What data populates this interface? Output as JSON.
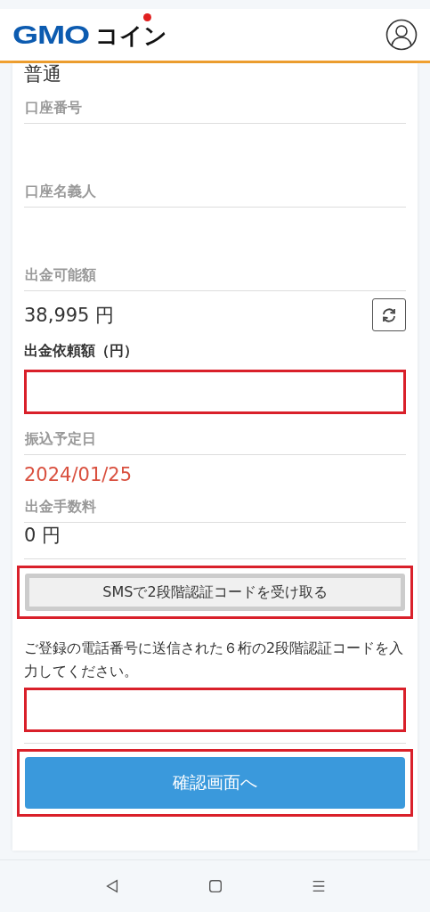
{
  "header": {
    "logo": {
      "latin": "GMO",
      "kana": "コイン"
    }
  },
  "account": {
    "type": "普通",
    "fields": [
      {
        "label": "口座番号"
      },
      {
        "label": "口座名義人"
      }
    ]
  },
  "available": {
    "label": "出金可能額",
    "value": "38,995 円"
  },
  "request": {
    "label": "出金依頼額（円）",
    "highlighted": true
  },
  "transfer_date": {
    "label": "振込予定日",
    "value": "2024/01/25"
  },
  "fee": {
    "label": "出金手数料",
    "value": "0 円"
  },
  "sms_button": {
    "label": "SMSで2段階認証コードを受け取る",
    "highlighted": true
  },
  "code_prompt": "ご登録の電話番号に送信された６桁の2段階認証コードを入力してください。",
  "code_field": {
    "highlighted": true
  },
  "confirm_button": {
    "label": "確認画面へ",
    "highlighted": true
  }
}
